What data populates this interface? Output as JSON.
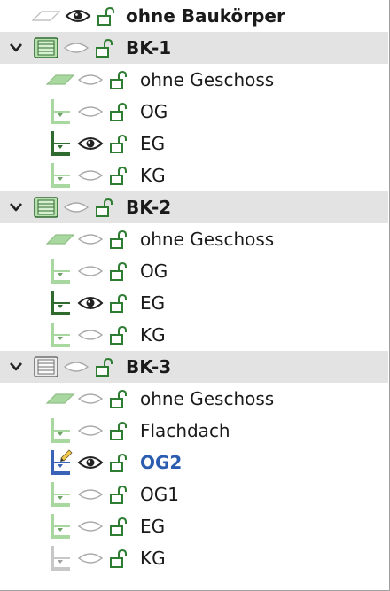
{
  "tree": {
    "top_item": {
      "label": "ohne Baukörper",
      "visible": true,
      "kind": "none"
    },
    "groups": [
      {
        "label": "BK-1",
        "expanded": true,
        "visible": false,
        "icon": "building-green",
        "children": [
          {
            "label": "ohne Geschoss",
            "kind": "plane",
            "visible": false
          },
          {
            "label": "OG",
            "kind": "floor",
            "visible": false
          },
          {
            "label": "EG",
            "kind": "floor-current",
            "visible": true
          },
          {
            "label": "KG",
            "kind": "floor",
            "visible": false
          }
        ]
      },
      {
        "label": "BK-2",
        "expanded": true,
        "visible": false,
        "icon": "building-green",
        "children": [
          {
            "label": "ohne Geschoss",
            "kind": "plane",
            "visible": false
          },
          {
            "label": "OG",
            "kind": "floor",
            "visible": false
          },
          {
            "label": "EG",
            "kind": "floor-current",
            "visible": true
          },
          {
            "label": "KG",
            "kind": "floor",
            "visible": false
          }
        ]
      },
      {
        "label": "BK-3",
        "expanded": true,
        "visible": false,
        "icon": "building-gray",
        "children": [
          {
            "label": "ohne Geschoss",
            "kind": "plane",
            "visible": false
          },
          {
            "label": "Flachdach",
            "kind": "floor",
            "visible": false
          },
          {
            "label": "OG2",
            "kind": "floor-edit",
            "visible": true,
            "active": true
          },
          {
            "label": "OG1",
            "kind": "floor",
            "visible": false
          },
          {
            "label": "EG",
            "kind": "floor",
            "visible": false
          },
          {
            "label": "KG",
            "kind": "floor-gray",
            "visible": false
          }
        ]
      }
    ]
  },
  "colors": {
    "group_bg": "#e3e3e3",
    "icon_green": "#3a8a3a",
    "icon_green_light": "#a8d8a0",
    "active_blue": "#2a5db0",
    "lock_green": "#2e7d32"
  }
}
